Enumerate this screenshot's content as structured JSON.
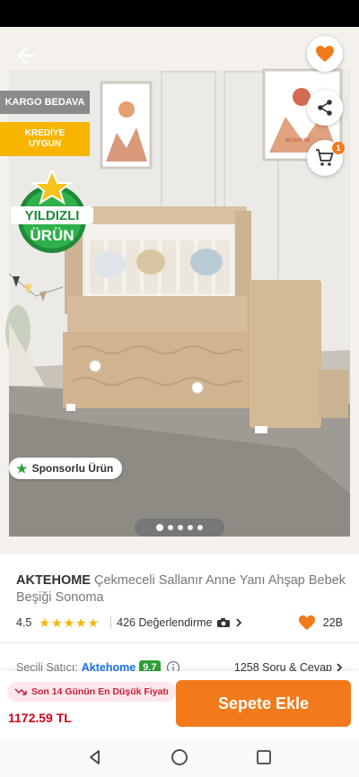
{
  "product": {
    "brand": "AKTEHOME",
    "name": "Çekmeceli Sallanır Anne Yanı Ahşap Bebek Beşiği Sonoma",
    "rating": "4.5",
    "rating_value": 4.5,
    "reviews": "426 Değerlendirme",
    "favorites": "22B"
  },
  "badges": {
    "kargo": "KARGO BEDAVA",
    "kredi_line1": "KREDİYE",
    "kredi_line2": "UYGUN",
    "yildizli_line1": "YILDIZLI",
    "yildizli_line2": "ÜRÜN",
    "sponsor": "Sponsorlu Ürün"
  },
  "image_brand": "AKTEHOME",
  "cart_count": "1",
  "carousel": {
    "count": 5,
    "active": 0
  },
  "seller": {
    "label": "Seçili Satıcı:",
    "name": "Aktehome",
    "score": "9.7",
    "qa": "1258 Soru & Cevap"
  },
  "bottom": {
    "lowest_label": "Son 14 Günün En Düşük Fiyatı",
    "price": "1172.59 TL",
    "add_label": "Sepete Ekle"
  },
  "colors": {
    "accent": "#f27a1a",
    "price": "#d0021b",
    "score": "#2e9e3b",
    "link": "#1a73e8"
  }
}
